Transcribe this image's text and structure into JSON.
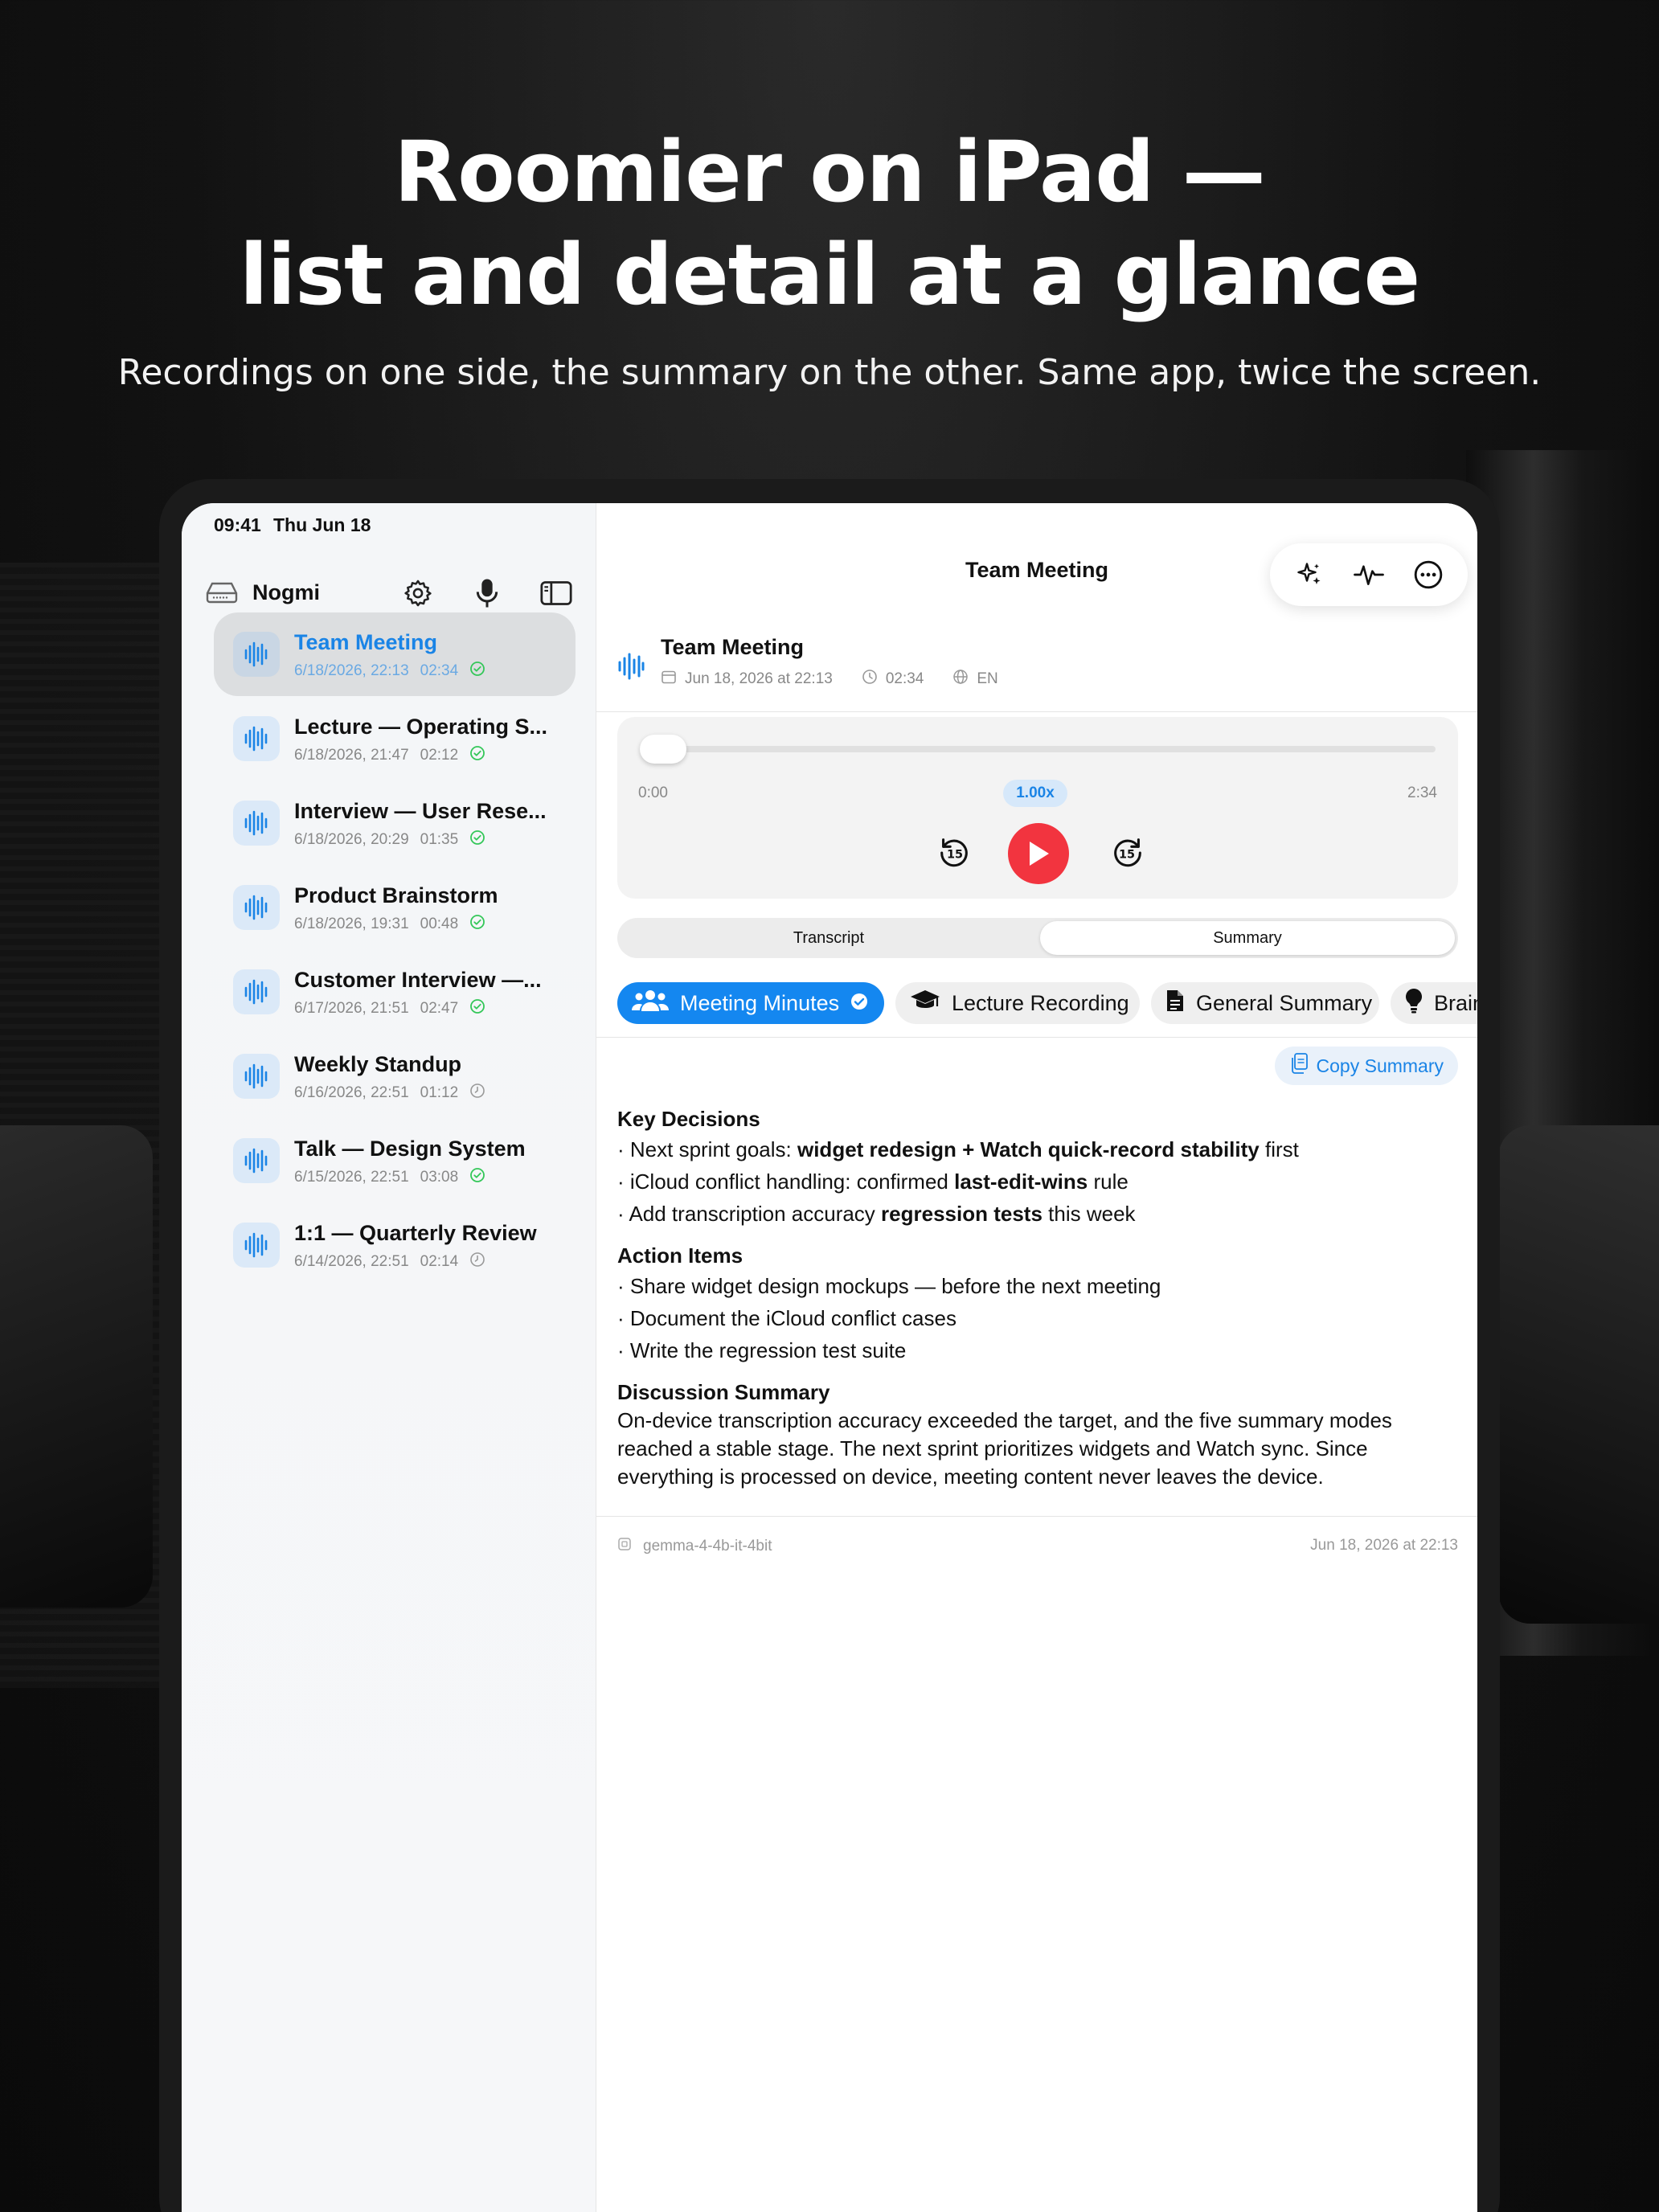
{
  "promo": {
    "headline_line1": "Roomier on iPad —",
    "headline_line2": "list and detail at a glance",
    "subhead": "Recordings on one side, the summary on the other. Same app, twice the screen."
  },
  "status_bar": {
    "time": "09:41",
    "date": "Thu Jun 18"
  },
  "sidebar": {
    "app_name": "Nogmi",
    "recordings": [
      {
        "title": "Team Meeting",
        "date": "6/18/2026, 22:13",
        "duration": "02:34",
        "status": "done",
        "active": true
      },
      {
        "title": "Lecture — Operating S...",
        "date": "6/18/2026, 21:47",
        "duration": "02:12",
        "status": "done"
      },
      {
        "title": "Interview — User Rese...",
        "date": "6/18/2026, 20:29",
        "duration": "01:35",
        "status": "done"
      },
      {
        "title": "Product Brainstorm",
        "date": "6/18/2026, 19:31",
        "duration": "00:48",
        "status": "done"
      },
      {
        "title": "Customer Interview —...",
        "date": "6/17/2026, 21:51",
        "duration": "02:47",
        "status": "done"
      },
      {
        "title": "Weekly Standup",
        "date": "6/16/2026, 22:51",
        "duration": "01:12",
        "status": "pending"
      },
      {
        "title": "Talk — Design System",
        "date": "6/15/2026, 22:51",
        "duration": "03:08",
        "status": "done"
      },
      {
        "title": "1:1 — Quarterly Review",
        "date": "6/14/2026, 22:51",
        "duration": "02:14",
        "status": "pending"
      }
    ]
  },
  "detail": {
    "nav_title": "Team Meeting",
    "recording": {
      "title": "Team Meeting",
      "date": "Jun 18, 2026 at 22:13",
      "duration": "02:34",
      "language": "EN"
    },
    "player": {
      "current": "0:00",
      "total": "2:34",
      "speed": "1.00x",
      "progress": 0.0
    },
    "tabs": {
      "transcript": "Transcript",
      "summary": "Summary",
      "selected": "Summary"
    },
    "modes": [
      {
        "label": "Meeting Minutes",
        "icon": "people-icon",
        "active": true
      },
      {
        "label": "Lecture Recording",
        "icon": "graduation-cap-icon"
      },
      {
        "label": "General Summary",
        "icon": "document-icon"
      },
      {
        "label": "Brain",
        "icon": "lightbulb-icon"
      }
    ],
    "copy_label": "Copy Summary",
    "summary": {
      "key_decisions_heading": "Key Decisions",
      "kd1_pre": "· Next sprint goals: ",
      "kd1_bold": "widget redesign + Watch quick-record stability",
      "kd1_post": " first",
      "kd2_pre": "· iCloud conflict handling: confirmed ",
      "kd2_bold": "last-edit-wins",
      "kd2_post": " rule",
      "kd3_pre": "· Add transcription accuracy ",
      "kd3_bold": "regression tests",
      "kd3_post": " this week",
      "action_items_heading": "Action Items",
      "ai1": "· Share widget design mockups — before the next meeting",
      "ai2": "· Document the iCloud conflict cases",
      "ai3": "· Write the regression test suite",
      "discussion_heading": "Discussion Summary",
      "discussion": "On-device transcription accuracy exceeded the target, and the five summary modes reached a stable stage. The next sprint prioritizes widgets and Watch sync. Since everything is processed on device, meeting content never leaves the device."
    },
    "footer": {
      "model": "gemma-4-4b-it-4bit",
      "generated": "Jun 18, 2026 at 22:13"
    }
  },
  "colors": {
    "accent": "#1487f0",
    "record_red": "#f2343f",
    "success": "#34c759"
  }
}
